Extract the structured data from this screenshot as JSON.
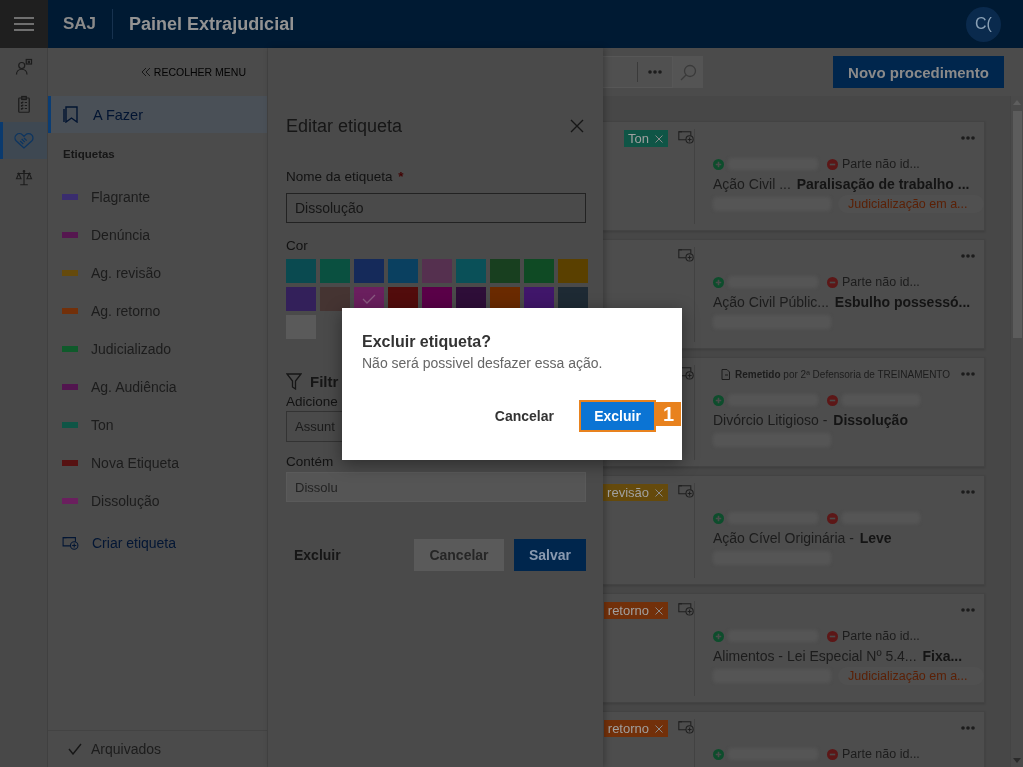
{
  "header": {
    "app": "SAJ",
    "title": "Painel Extrajudicial",
    "avatar": "C("
  },
  "rail": [
    {
      "kind": "person",
      "selected": false
    },
    {
      "kind": "clipboard",
      "selected": false
    },
    {
      "kind": "handshake",
      "selected": true
    },
    {
      "kind": "scales",
      "selected": false
    }
  ],
  "sidebar": {
    "collapse": "RECOLHER MENU",
    "items": [
      {
        "label": "A Fazer",
        "selected": true
      }
    ],
    "section": "Etiquetas",
    "tags": [
      {
        "label": "Flagrante",
        "color": "#3a2d6e"
      },
      {
        "label": "Denúncia",
        "color": "#55174f"
      },
      {
        "label": "Ag. revisão",
        "color": "#654a0c"
      },
      {
        "label": "Ag. retorno",
        "color": "#72300a"
      },
      {
        "label": "Judicializado",
        "color": "#0f5a2b"
      },
      {
        "label": "Ag. Audiência",
        "color": "#52154f"
      },
      {
        "label": "Ton",
        "color": "#0f5546"
      },
      {
        "label": "Nova Etiqueta",
        "color": "#561212"
      },
      {
        "label": "Dissolução",
        "color": "#6a1f5e"
      }
    ],
    "create": "Criar etiqueta",
    "footer": "Arquivados"
  },
  "edit_panel": {
    "title": "Editar etiqueta",
    "name_label": "Nome da etiqueta",
    "required_mark": "*",
    "name_value": "Dissolução",
    "color_label": "Cor",
    "swatches": [
      {
        "color": "#0a4a50",
        "selected": false
      },
      {
        "color": "#0a5040",
        "selected": false
      },
      {
        "color": "#152a5a",
        "selected": false
      },
      {
        "color": "#0a4060",
        "selected": false
      },
      {
        "color": "#55304f",
        "selected": false
      },
      {
        "color": "#0a5058",
        "selected": false
      },
      {
        "color": "#183f1f",
        "selected": false
      },
      {
        "color": "#0f4a24",
        "selected": false
      },
      {
        "color": "#5a4000",
        "selected": false
      },
      {
        "color": "#33205a",
        "selected": false
      },
      {
        "color": "#453432",
        "selected": false
      },
      {
        "color": "#6a1f5e",
        "selected": true
      },
      {
        "color": "#520c0c",
        "selected": false
      },
      {
        "color": "#5a0048",
        "selected": false
      },
      {
        "color": "#2e0e38",
        "selected": false
      },
      {
        "color": "#6a2a00",
        "selected": false
      },
      {
        "color": "#40166a",
        "selected": false
      },
      {
        "color": "#1e2a34",
        "selected": false
      },
      {
        "color": "#5a5a5a",
        "selected": false
      }
    ],
    "filter_title": "Filtr",
    "filter_hint": "Adicione",
    "subject_placeholder": "Assunt",
    "contains_label": "Contém",
    "contains_field": {
      "value": "Dissolu",
      "disabled": true
    },
    "buttons": [
      {
        "label": "Excluir",
        "kind": "text"
      },
      {
        "label": "Cancelar",
        "kind": "secondary"
      },
      {
        "label": "Salvar",
        "kind": "primary"
      }
    ]
  },
  "toolbar": {
    "new_button": "Novo procedimento"
  },
  "cards": [
    {
      "tag": {
        "label": "Ton",
        "color": "#0f5546"
      },
      "parties": [
        {
          "kind": "plus"
        },
        {
          "kind": "minus",
          "name": "Parte não id..."
        }
      ],
      "class": "Ação Civil ...",
      "subject": "Paralisação de trabalho ...",
      "status": "Judicialização em a..."
    },
    {
      "parties": [
        {
          "kind": "plus"
        },
        {
          "kind": "minus",
          "name": "Parte não id..."
        }
      ],
      "class": "Ação Civil Públic...",
      "subject": "Esbulho possessó..."
    },
    {
      "forwarded": {
        "label": "Remetido",
        "by": "por 2ª Defensoria de TREINAMENTO"
      },
      "parties": [
        {
          "kind": "plus"
        },
        {
          "kind": "minus"
        }
      ],
      "class": "Divórcio Litigioso -",
      "subject": "Dissolução"
    },
    {
      "tag": {
        "label": "revisão",
        "color": "#654a0c"
      },
      "parties": [
        {
          "kind": "plus"
        },
        {
          "kind": "minus"
        }
      ],
      "class": "Ação Cível Originária -",
      "subject": "Leve"
    },
    {
      "tag": {
        "label": "retorno",
        "color": "#72300a"
      },
      "parties": [
        {
          "kind": "plus"
        },
        {
          "kind": "minus",
          "name": "Parte não id..."
        }
      ],
      "class": "Alimentos - Lei Especial Nº 5.4...",
      "subject": "Fixa...",
      "status": "Judicialização em a..."
    },
    {
      "tag": {
        "label": "retorno",
        "color": "#72300a"
      },
      "parties": [
        {
          "kind": "plus"
        },
        {
          "kind": "minus",
          "name": "Parte não id..."
        }
      ]
    }
  ],
  "dialog": {
    "title": "Excluir etiqueta?",
    "message": "Não será possivel desfazer essa ação.",
    "buttons": [
      {
        "label": "Cancelar",
        "kind": "text",
        "highlighted": false
      },
      {
        "label": "Excluir",
        "kind": "primary",
        "highlighted": true
      }
    ],
    "step_badge": "1"
  }
}
